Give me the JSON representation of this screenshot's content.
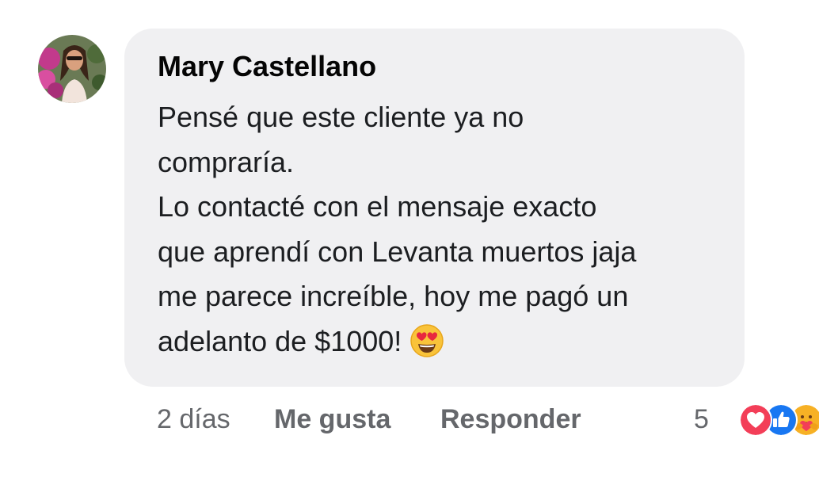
{
  "comment": {
    "author": "Mary Castellano",
    "lines": [
      "Pensé que este cliente ya no",
      "compraría.",
      "Lo contacté con el mensaje exacto",
      "que aprendí con Levanta muertos jaja",
      "me parece increíble, hoy me pagó un",
      "adelanto de $1000!"
    ],
    "emoji": "smiling-face-with-heart-eyes-icon"
  },
  "actions": {
    "time": "2 días",
    "like_label": "Me gusta",
    "reply_label": "Responder"
  },
  "reactions": {
    "count": "5",
    "icons": [
      "love-reaction-icon",
      "like-reaction-icon",
      "care-reaction-icon"
    ]
  },
  "colors": {
    "bubble_bg": "#f0f0f2",
    "meta_text": "#65676b",
    "love_red": "#f33e58",
    "like_blue": "#1877f2",
    "care_yellow": "#f7b125"
  }
}
